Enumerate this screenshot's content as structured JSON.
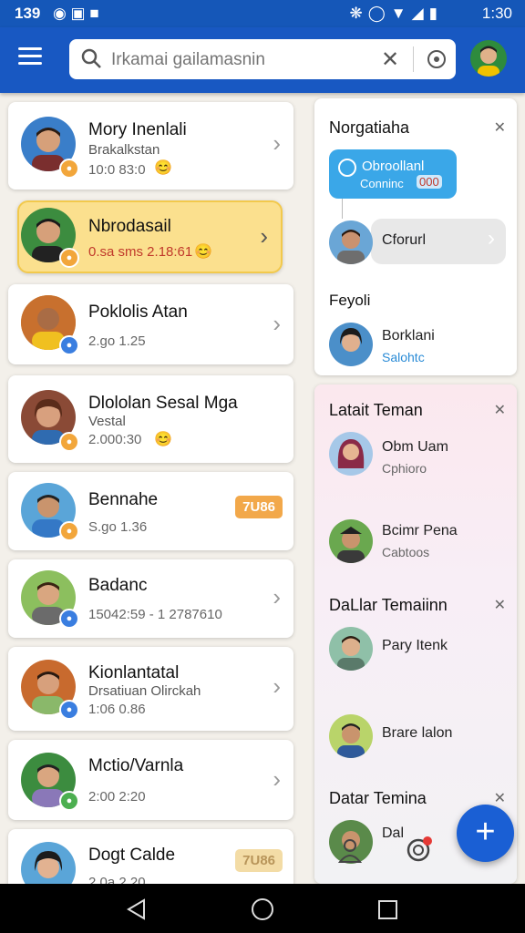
{
  "status_bar": {
    "time": "139",
    "time_right": "1:30"
  },
  "search": {
    "placeholder": "Irkamai gailamasnin"
  },
  "contacts": [
    {
      "name": "Mory Inenlali",
      "sub": "Brakalkstan",
      "meta": "10:0 83:0"
    },
    {
      "name": "Nbrodasail",
      "sub": "",
      "meta": "0.sa sms 2.18:61"
    },
    {
      "name": "Poklolis Atan",
      "sub": "",
      "meta": "2.go 1.25"
    },
    {
      "name": "Dlololan Sesal Mga",
      "sub": "Vestal",
      "meta": "2.000:30"
    },
    {
      "name": "Bennahe",
      "sub": "",
      "meta": "S.go 1.36",
      "pill": "7U86"
    },
    {
      "name": "Badanc",
      "sub": "",
      "meta": "15042:59 - 1 2787610"
    },
    {
      "name": "Kionlantatal",
      "sub": "Drsatiuan Olirckah",
      "meta": "1:06 0.86"
    },
    {
      "name": "Mctio/Varnla",
      "sub": "",
      "meta": "2:00 2:20"
    },
    {
      "name": "Dogt Calde",
      "sub": "",
      "meta": "2.0a 2.20",
      "pill": "7U86"
    }
  ],
  "panel1": {
    "title": "Norgatiaha",
    "bubble_title": "Obroollanl",
    "bubble_sub": "Conninc",
    "bubble_count": "000",
    "item_name": "Cforurl",
    "section_title": "Feyoli",
    "person_name": "Borklani",
    "person_sub": "Salohtc"
  },
  "panel2": {
    "title": "Latait Teman",
    "people": [
      {
        "name": "Obm Uam",
        "sub": "Cphioro"
      },
      {
        "name": "Bcimr Pena",
        "sub": "Cabtoos"
      }
    ],
    "section2_title": "DaLlar Temaiinn",
    "people2": [
      {
        "name": "Pary Itenk",
        "sub": ""
      },
      {
        "name": "Brare lalon",
        "sub": ""
      }
    ],
    "section3_title": "Datar Temina",
    "last_name": "Dal"
  },
  "colors": {
    "app_bar": "#1858c2",
    "highlight": "#fbe08e",
    "fab": "#1a5fd4",
    "bubble": "#3aa7e8",
    "pill": "#f2a84a"
  },
  "icons": [
    "menu-icon",
    "search-icon",
    "clear-icon",
    "gps-icon",
    "chevron-right-icon",
    "close-icon",
    "person-icon",
    "target-icon",
    "plus-icon",
    "back-icon",
    "home-icon",
    "recents-icon"
  ]
}
